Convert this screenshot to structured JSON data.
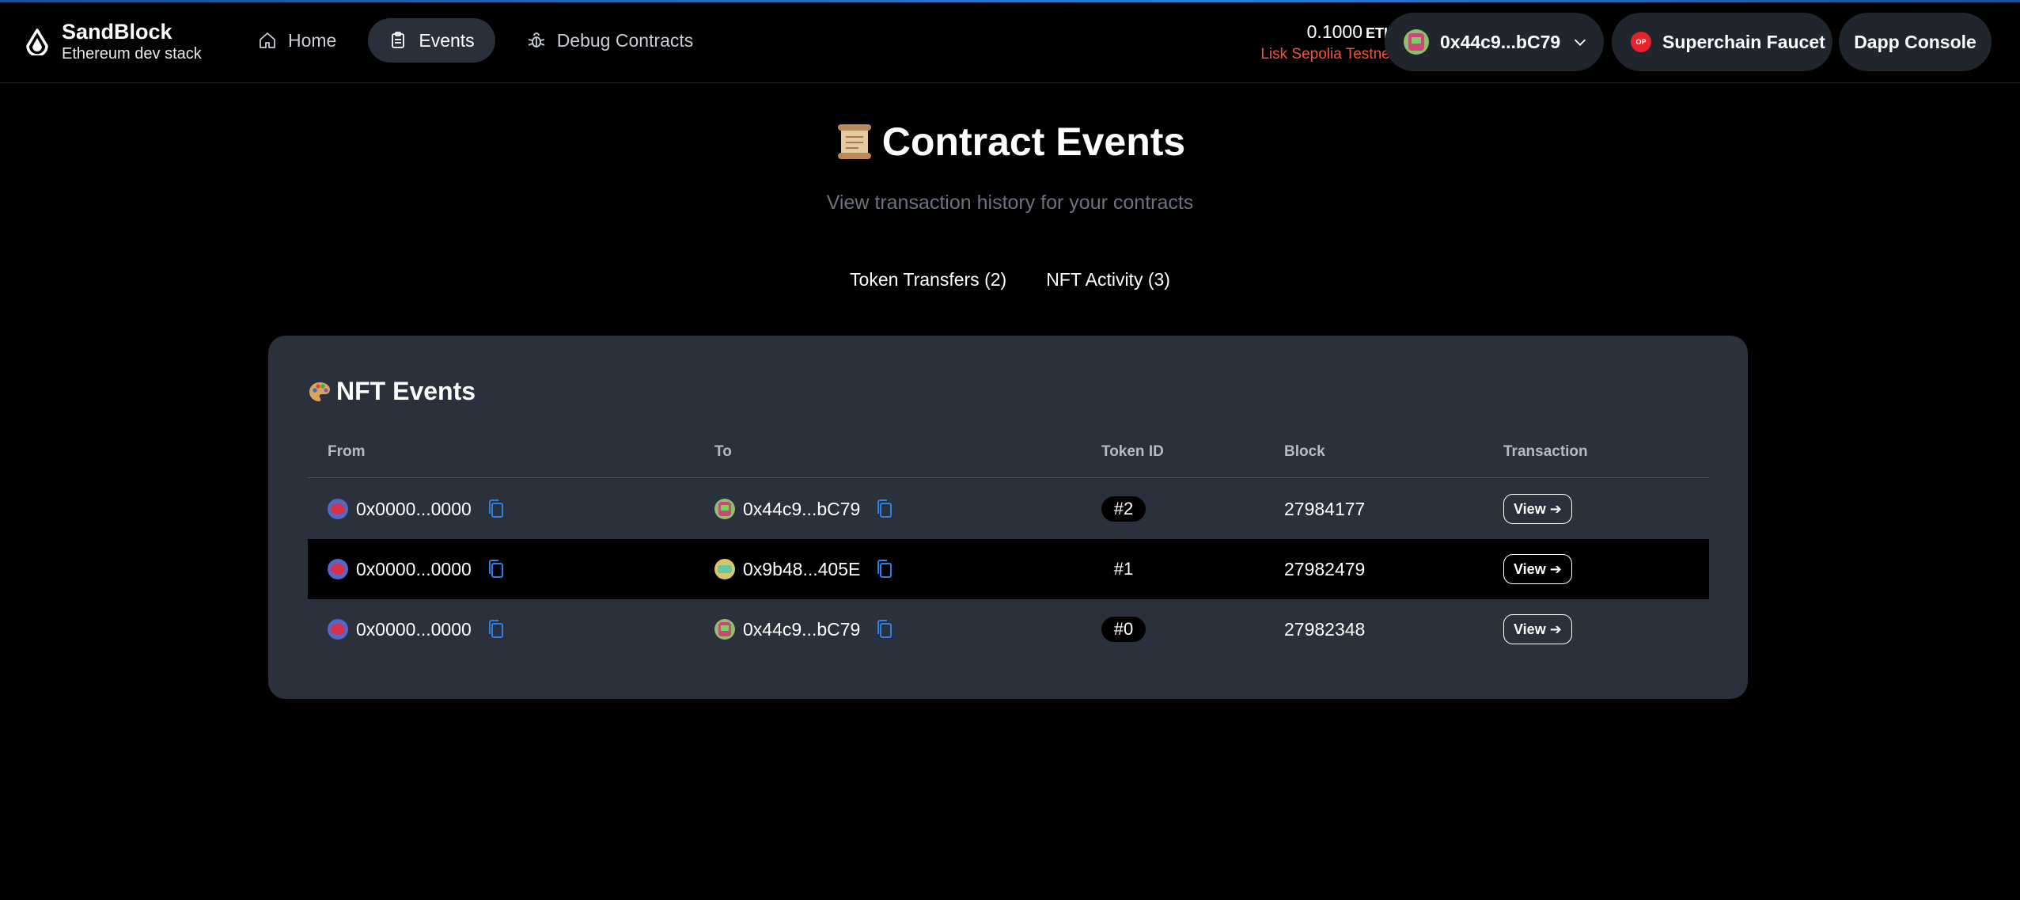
{
  "brand": {
    "name": "SandBlock",
    "tagline": "Ethereum dev stack"
  },
  "nav": [
    {
      "label": "Home",
      "icon": "home-icon",
      "active": false
    },
    {
      "label": "Events",
      "icon": "clipboard-icon",
      "active": true
    },
    {
      "label": "Debug Contracts",
      "icon": "bug-icon",
      "active": false
    }
  ],
  "balance": {
    "amount": "0.1000",
    "unit": "ETH",
    "network": "Lisk Sepolia Testnet",
    "network_color": "#f0543c"
  },
  "wallet": {
    "address": "0x44c9...bC79"
  },
  "faucet": {
    "label": "Superchain Faucet",
    "badge": "OP"
  },
  "console": {
    "label": "Dapp Console"
  },
  "page": {
    "title": "Contract Events",
    "subtitle": "View transaction history for your contracts"
  },
  "tabs": [
    {
      "label": "Token Transfers (2)"
    },
    {
      "label": "NFT Activity (3)"
    }
  ],
  "card": {
    "title": "NFT Events",
    "columns": [
      "From",
      "To",
      "Token ID",
      "Block",
      "Transaction"
    ],
    "rows": [
      {
        "from": "0x0000...0000",
        "to": "0x44c9...bC79",
        "token_id": "#2",
        "block": "27984177",
        "action": "View ➔"
      },
      {
        "from": "0x0000...0000",
        "to": "0x9b48...405E",
        "token_id": "#1",
        "block": "27982479",
        "action": "View ➔"
      },
      {
        "from": "0x0000...0000",
        "to": "0x44c9...bC79",
        "token_id": "#0",
        "block": "27982348",
        "action": "View ➔"
      }
    ]
  },
  "colors": {
    "background": "#000000",
    "card": "#2a303c",
    "pill": "#20252e",
    "copy_icon": "#2f7fe0"
  }
}
